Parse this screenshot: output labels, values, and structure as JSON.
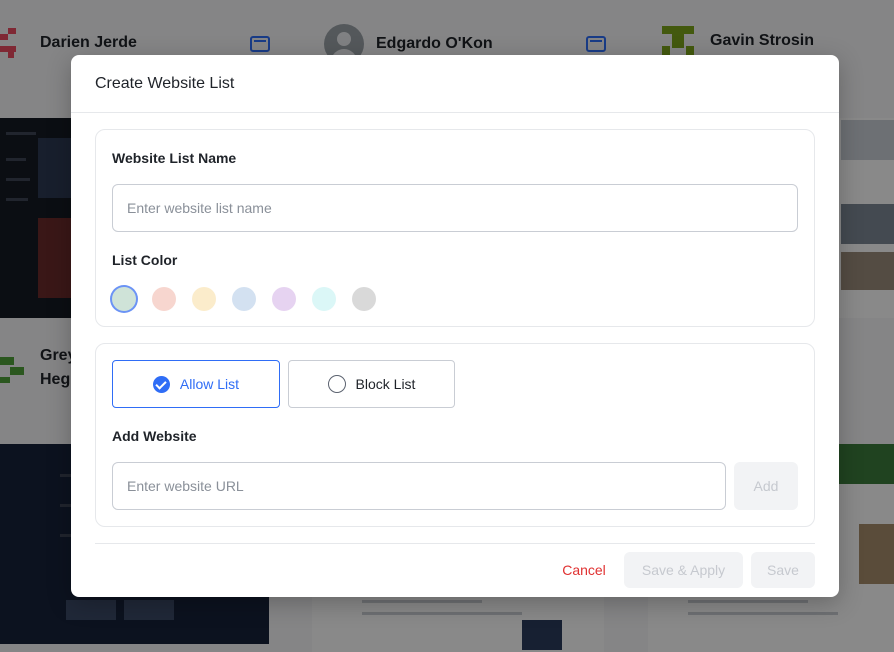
{
  "background": {
    "users": [
      {
        "name": "Darien Jerde"
      },
      {
        "name": "Edgardo O'Kon"
      },
      {
        "name": "Gavin Strosin"
      },
      {
        "name": "Grey Heg"
      }
    ],
    "icons": {
      "device": "browser-window-icon"
    }
  },
  "modal": {
    "title": "Create Website List",
    "name_section": {
      "label": "Website List Name",
      "placeholder": "Enter website list name",
      "value": ""
    },
    "color_section": {
      "label": "List Color",
      "swatches": [
        {
          "color": "#cfe3d8",
          "selected": true
        },
        {
          "color": "#f7d6cf"
        },
        {
          "color": "#fbeccb"
        },
        {
          "color": "#d3e1f1"
        },
        {
          "color": "#e6d3f1"
        },
        {
          "color": "#dbf7f7"
        },
        {
          "color": "#d9d9d9"
        }
      ]
    },
    "list_type": {
      "options": [
        {
          "label": "Allow List",
          "selected": true
        },
        {
          "label": "Block List",
          "selected": false
        }
      ]
    },
    "add_website": {
      "label": "Add Website",
      "placeholder": "Enter website URL",
      "value": "",
      "add_label": "Add"
    },
    "footer": {
      "cancel_label": "Cancel",
      "save_apply_label": "Save & Apply",
      "save_label": "Save"
    }
  },
  "colors": {
    "accent": "#2f6df6",
    "danger": "#e03131",
    "overlay": "rgba(0,0,0,0.45)"
  }
}
